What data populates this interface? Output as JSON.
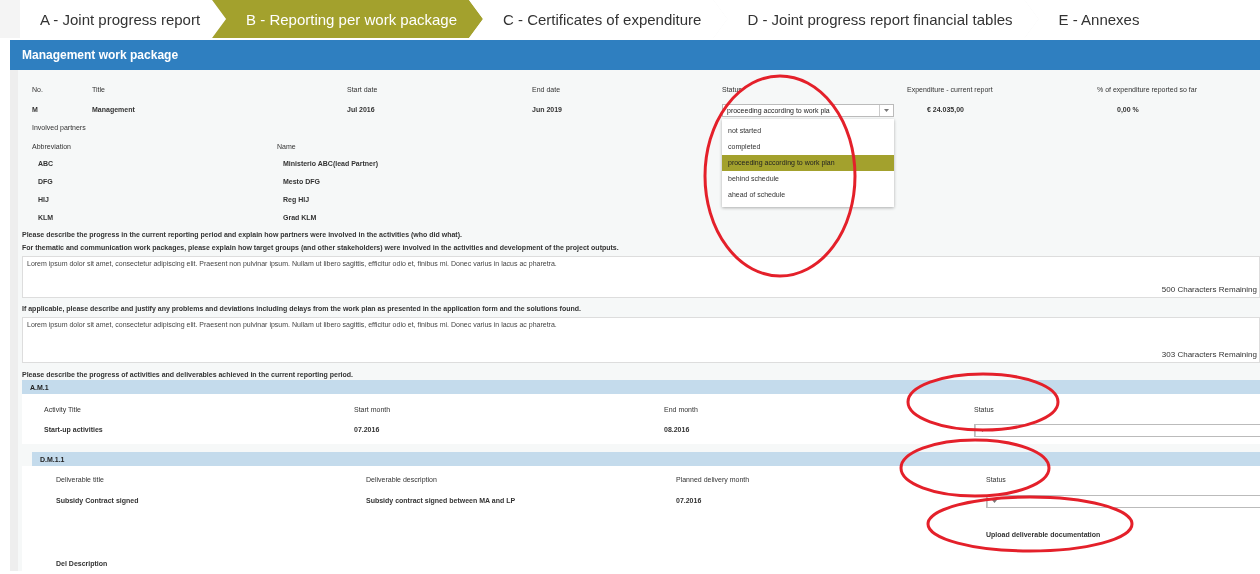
{
  "tabs": [
    {
      "label": "A - Joint progress report",
      "selected": false
    },
    {
      "label": "B - Reporting per work package",
      "selected": true
    },
    {
      "label": "C - Certificates of expenditure",
      "selected": false
    },
    {
      "label": "D - Joint progress report financial tables",
      "selected": false
    },
    {
      "label": "E - Annexes",
      "selected": false
    }
  ],
  "panel_title": "Management work package",
  "info": {
    "no_label": "No.",
    "no": "M",
    "title_label": "Title",
    "title": "Management",
    "start_label": "Start date",
    "start": "Jul 2016",
    "end_label": "End date",
    "end": "Jun 2019",
    "status_label": "Status",
    "status": "proceeding according to work pla",
    "expenditure_label": "Expenditure - current report",
    "expenditure": "€ 24.035,00",
    "share_label": "% of expenditure reported so far",
    "share": "0,00 %"
  },
  "status_options": [
    {
      "label": "not started",
      "selected": false
    },
    {
      "label": "completed",
      "selected": false
    },
    {
      "label": "proceeding according to work plan",
      "selected": true
    },
    {
      "label": "behind schedule",
      "selected": false
    },
    {
      "label": "ahead of schedule",
      "selected": false
    }
  ],
  "partners": {
    "title": "Involved partners",
    "abbr_label": "Abbreviation",
    "name_label": "Name",
    "rows": [
      {
        "abbr": "ABC",
        "name": "Ministerio ABC(lead Partner)"
      },
      {
        "abbr": "DFG",
        "name": "Mesto DFG"
      },
      {
        "abbr": "HIJ",
        "name": "Reg HIJ"
      },
      {
        "abbr": "KLM",
        "name": "Grad KLM"
      }
    ]
  },
  "questions": [
    {
      "lines": [
        "Please describe the progress in the current reporting period and explain how partners were involved in the activities (who did what).",
        "For thematic and communication work packages, please explain how target groups (and other stakeholders) were involved in the activities and development of the project outputs."
      ],
      "answer": "Lorem ipsum dolor sit amet, consectetur adipiscing elit. Praesent non pulvinar ipsum. Nullam ut libero sagittis, efficitur odio et, finibus mi. Donec varius in lacus ac pharetra.",
      "remaining": "500 Characters Remaining"
    },
    {
      "lines": [
        "If applicable, please describe and justify any problems and deviations including delays from the work plan as presented in the application form and the solutions found."
      ],
      "answer": "Lorem ipsum dolor sit amet, consectetur adipiscing elit. Praesent non pulvinar ipsum. Nullam ut libero sagittis, efficitur odio et, finibus mi. Donec varius in lacus ac pharetra.",
      "remaining": "303 Characters Remaining"
    }
  ],
  "progress_prompt": "Please describe the progress of activities and deliverables achieved in the current reporting period.",
  "activity": {
    "code": "A.M.1",
    "title_label": "Activity Title",
    "title": "Start-up activities",
    "start_label": "Start month",
    "start": "07.2016",
    "end_label": "End month",
    "end": "08.2016",
    "status_label": "Status"
  },
  "deliverable": {
    "code": "D.M.1.1",
    "title_label": "Deliverable title",
    "title": "Subsidy Contract signed",
    "desc_label": "Deliverable description",
    "desc": "Subsidy contract signed between MA and LP",
    "month_label": "Planned delivery month",
    "month": "07.2016",
    "status_label": "Status",
    "upload": "Upload deliverable documentation",
    "description_label": "Del Description"
  }
}
